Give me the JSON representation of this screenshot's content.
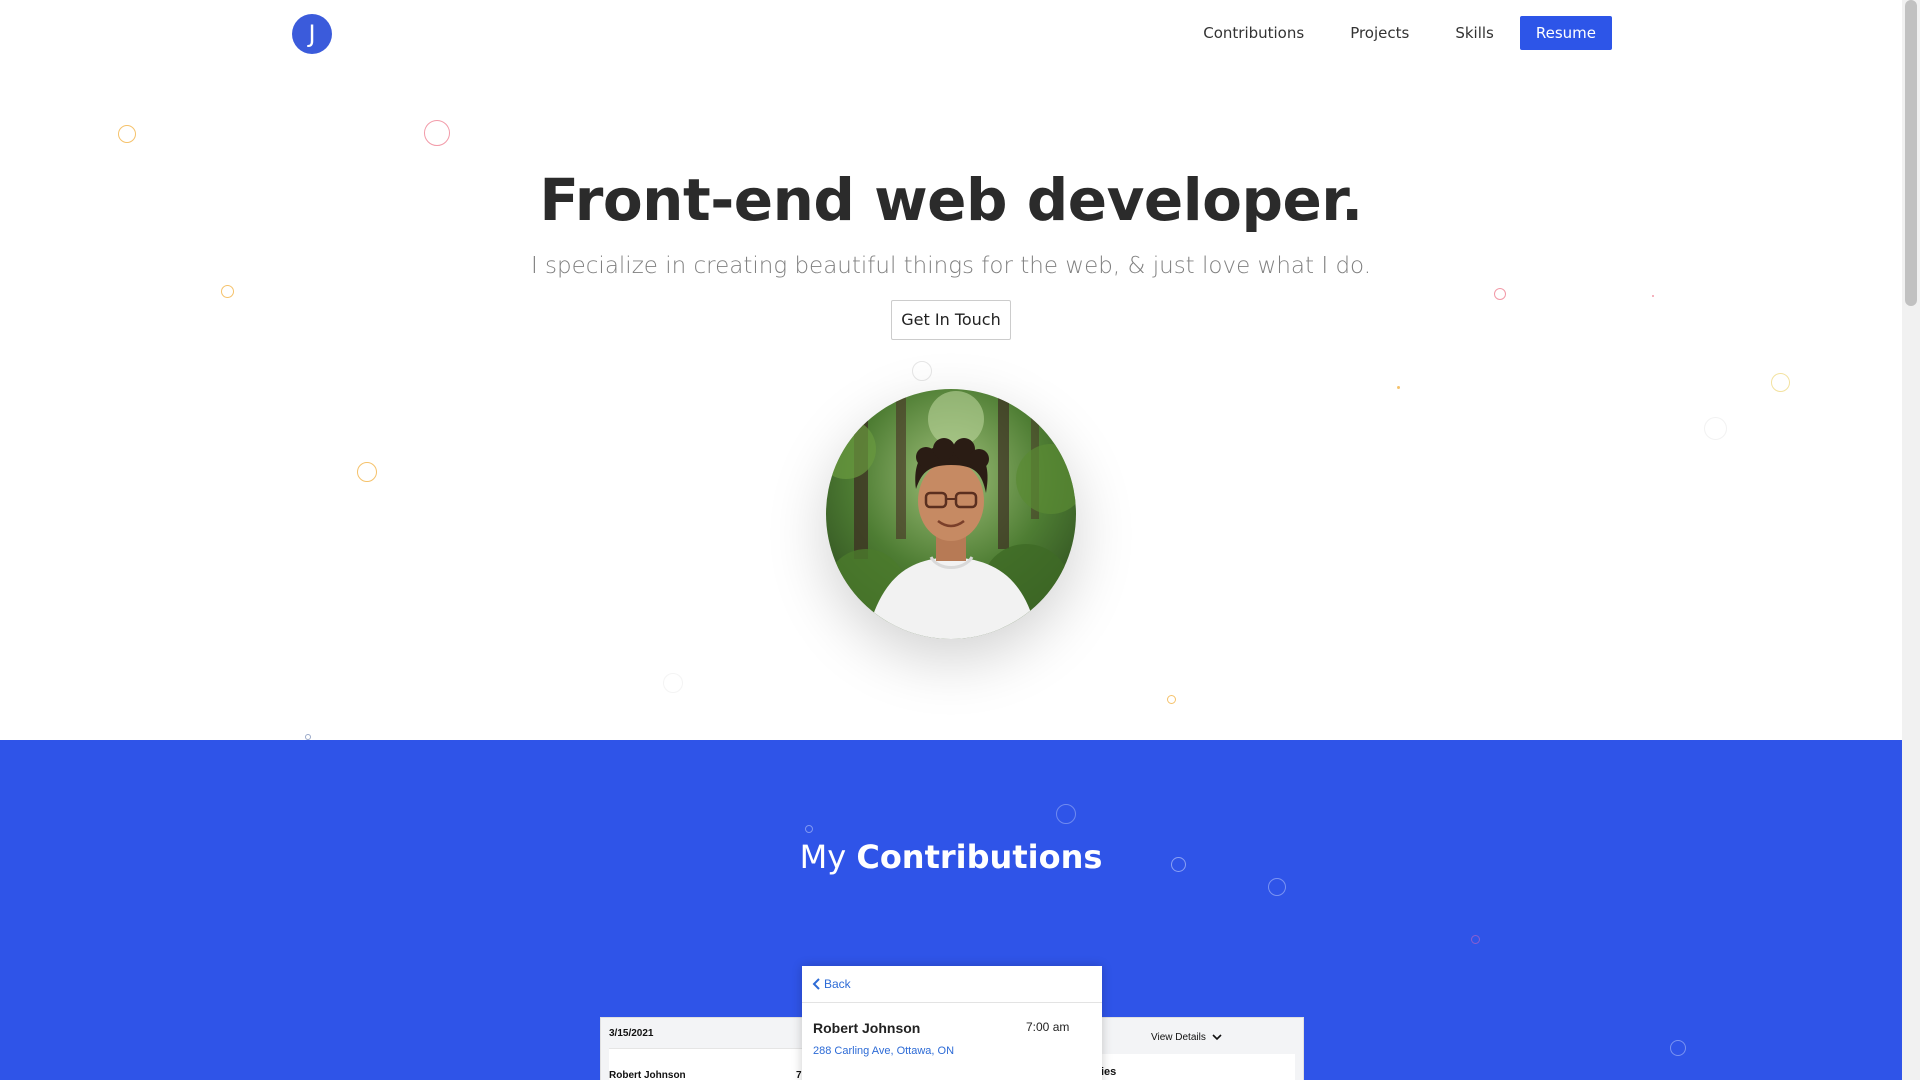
{
  "header": {
    "logo_letter": "J",
    "nav": {
      "contributions": "Contributions",
      "projects": "Projects",
      "skills": "Skills",
      "resume": "Resume"
    }
  },
  "hero": {
    "title": "Front-end web developer.",
    "subtitle": "I specialize in creating beautiful things for the web, & just love what I do.",
    "cta_label": "Get In Touch"
  },
  "contributions": {
    "heading_prefix": "My",
    "heading_bold": "Contributions"
  },
  "mockup": {
    "left_card": {
      "date": "3/15/2021",
      "name": "Robert Johnson",
      "partial_number": "7"
    },
    "main_card": {
      "back_label": "Back",
      "name": "Robert Johnson",
      "time": "7:00 am",
      "address": "288 Carling Ave, Ottawa, ON"
    },
    "right_card": {
      "view_details_label": "View Details",
      "partial_text": "ies"
    }
  },
  "colors": {
    "accent_blue": "#2f54e8",
    "logo_blue": "#3b5bdb",
    "link_blue": "#2d6bd6",
    "bubble_orange": "#f5c26b",
    "bubble_pink": "#f29aa8"
  }
}
